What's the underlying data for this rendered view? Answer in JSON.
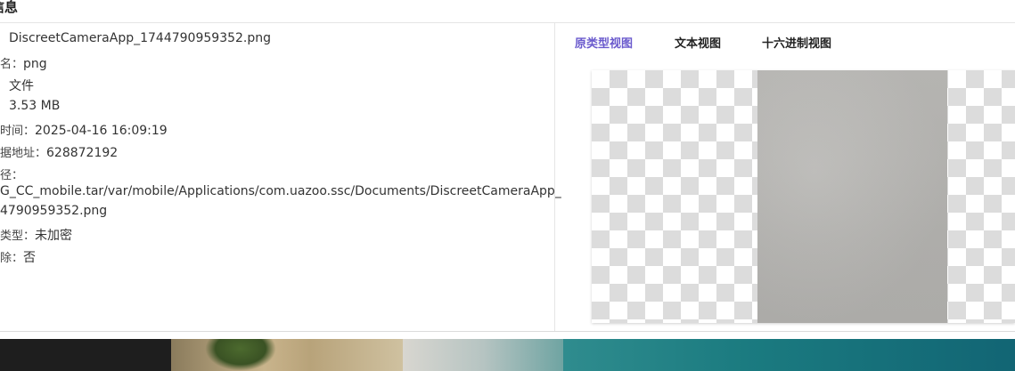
{
  "panel": {
    "title": "信息"
  },
  "info": {
    "name": {
      "label": "",
      "value": "DiscreetCameraApp_1744790959352.png"
    },
    "ext": {
      "label": "名：",
      "value": "png"
    },
    "type": {
      "label": "",
      "value": "文件"
    },
    "size": {
      "label": "",
      "value": "3.53 MB"
    },
    "time": {
      "label": "时间：",
      "value": "2025-04-16 16:09:19"
    },
    "address": {
      "label": "据地址：",
      "value": "628872192"
    },
    "path": {
      "label": "径：",
      "line1": "G_CC_mobile.tar/var/mobile/Applications/com.uazoo.ssc/Documents/DiscreetCameraApp_",
      "line2": "4790959352.png"
    },
    "encryption": {
      "label": "类型：",
      "value": "未加密"
    },
    "deleted": {
      "label": "除：",
      "value": "否"
    }
  },
  "tabs": [
    {
      "label": "原类型视图",
      "active": true
    },
    {
      "label": "文本视图",
      "active": false
    },
    {
      "label": "十六进制视图",
      "active": false
    }
  ],
  "colors": {
    "accent": "#6a5acd",
    "checker_dark": "#dcdcdc",
    "checker_light": "#ffffff"
  }
}
